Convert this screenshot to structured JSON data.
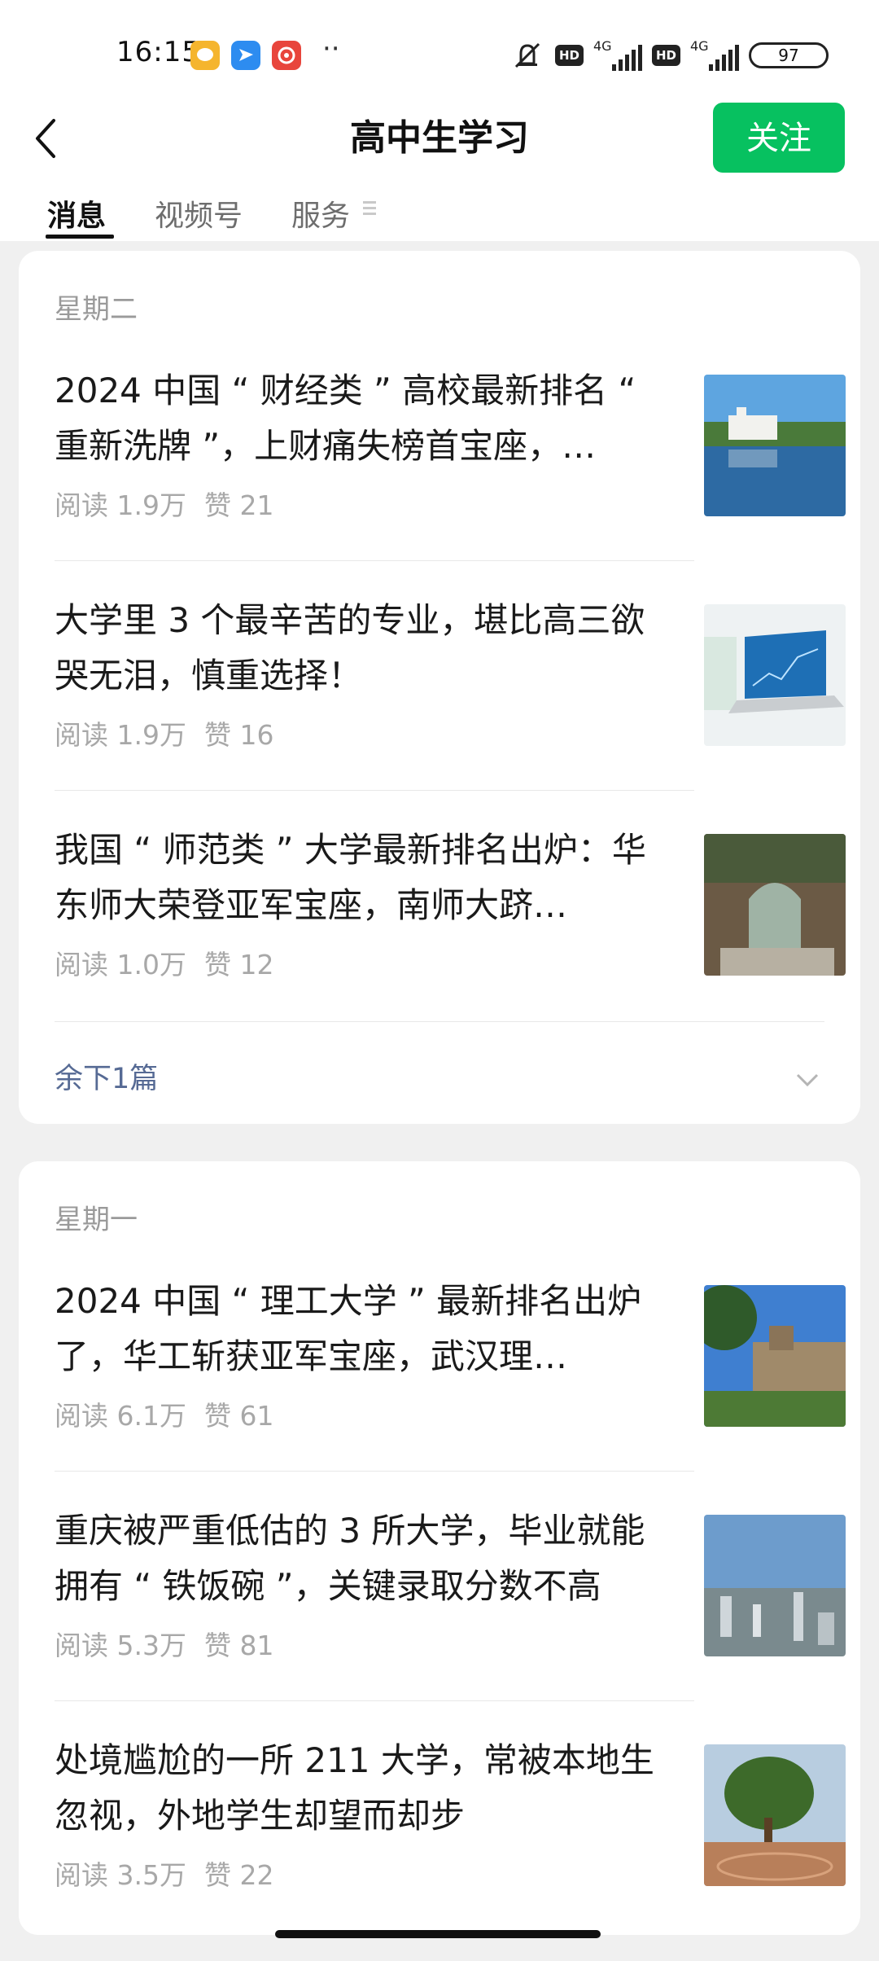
{
  "status_bar": {
    "time": "16:15",
    "network_1": "4G",
    "network_2": "4G",
    "hd_1": "HD",
    "hd_2": "HD",
    "battery": "97"
  },
  "header": {
    "title": "高中生学习",
    "follow_label": "关注",
    "back_icon": "chevron-left-icon"
  },
  "tabs": [
    {
      "label": "消息",
      "active": true
    },
    {
      "label": "视频号",
      "active": false
    },
    {
      "label": "服务",
      "active": false
    }
  ],
  "groups": [
    {
      "day": "星期二",
      "articles": [
        {
          "title": "2024 中国 “ 财经类 ” 高校最新排名 “ 重新洗牌 ”，上财痛失榜首宝座，…",
          "reads": "阅读 1.9万",
          "likes": "赞 21",
          "thumb": "lake-campus-image"
        },
        {
          "title": "大学里 3 个最辛苦的专业，堪比高三欲哭无泪，慎重选择！",
          "reads": "阅读 1.9万",
          "likes": "赞 16",
          "thumb": "laptop-chart-image"
        },
        {
          "title": "我国 “ 师范类 ” 大学最新排名出炉：华东师大荣登亚军宝座，南师大跻…",
          "reads": "阅读 1.0万",
          "likes": "赞 12",
          "thumb": "stone-archway-image"
        }
      ],
      "remaining": "余下1篇"
    },
    {
      "day": "星期一",
      "articles": [
        {
          "title": "2024 中国 “ 理工大学 ” 最新排名出炉了，华工斩获亚军宝座，武汉理…",
          "reads": "阅读 6.1万",
          "likes": "赞 61",
          "thumb": "campus-building-image"
        },
        {
          "title": "重庆被严重低估的 3 所大学，毕业就能拥有 “ 铁饭碗 ”，关键录取分数不高",
          "reads": "阅读 5.3万",
          "likes": "赞 81",
          "thumb": "city-skyline-image"
        },
        {
          "title": "处境尴尬的一所 211 大学，常被本地生忽视，外地学生却望而却步",
          "reads": "阅读 3.5万",
          "likes": "赞 22",
          "thumb": "tree-plaza-image"
        }
      ]
    }
  ]
}
